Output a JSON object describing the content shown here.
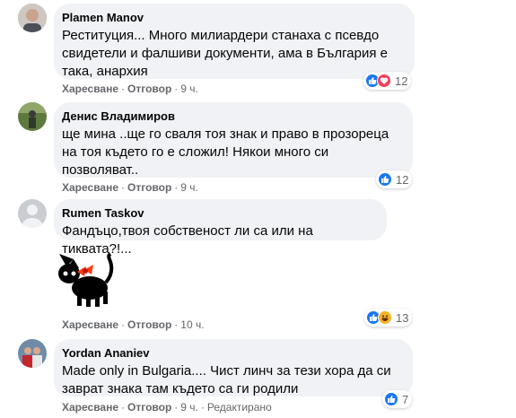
{
  "comments": [
    {
      "author": "Plamen Manov",
      "lines": [
        "Реституция... Много милиардери станаха с псевдо",
        "свидетели и фалшиви документи, ама в България е",
        "така, анархия"
      ],
      "like_label": "Харесване",
      "reply_label": "Отговор",
      "time": "9 ч.",
      "reactions": [
        "like-icon",
        "love-icon"
      ],
      "reaction_count": "12"
    },
    {
      "author": "Денис Владимиров",
      "lines": [
        "ще мина ..ще го сваля тоя знак и право в прозореца",
        "на тоя където го е сложил! Някои много си",
        "позволяват.."
      ],
      "like_label": "Харесване",
      "reply_label": "Отговор",
      "time": "9 ч.",
      "reactions": [
        "like-icon"
      ],
      "reaction_count": "12"
    },
    {
      "author": "Rumen Taskov",
      "lines": [
        "Фандъцо,твоя собственост ли са или на тиквата?!..."
      ],
      "like_label": "Харесване",
      "reply_label": "Отговор",
      "time": "10 ч.",
      "reactions": [
        "like-icon",
        "haha-icon"
      ],
      "reaction_count": "13",
      "sticker": "black-cat-with-red-bow-sticker"
    },
    {
      "author": "Yordan Ananiev",
      "lines": [
        "Made only in Bulgaria.... Чист линч за тези хора да си",
        "заврат знака там където са ги родили"
      ],
      "like_label": "Харесване",
      "reply_label": "Отговор",
      "time": "9 ч.",
      "edited_label": "Редактирано",
      "reactions": [
        "like-icon"
      ],
      "reaction_count": "7"
    }
  ],
  "colors": {
    "bubble": "#f0f2f5",
    "meta_text": "#65676b",
    "like": "#1877f2",
    "love": "#f33e58",
    "haha": "#f7b125"
  }
}
